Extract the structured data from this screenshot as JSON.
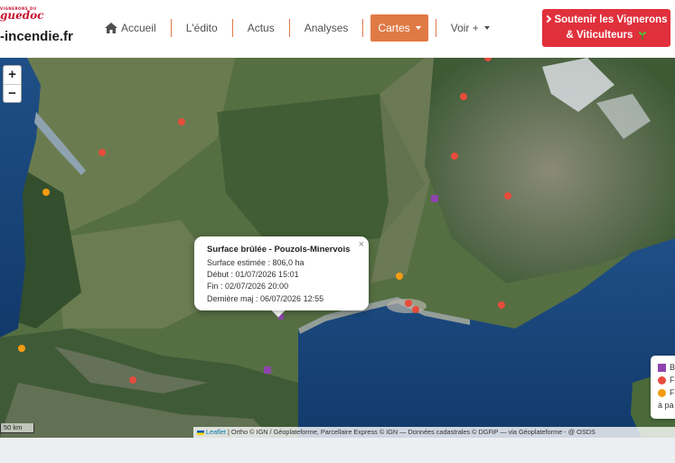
{
  "site": {
    "logo_kicker": "VIGNERONS DU",
    "logo_script": "guedoc",
    "logo_domain": "-incendie.fr"
  },
  "nav": {
    "items": [
      {
        "label": "Accueil",
        "icon": "home-icon"
      },
      {
        "label": "L'édito"
      },
      {
        "label": "Actus"
      },
      {
        "label": "Analyses"
      },
      {
        "label": "Cartes",
        "active": true,
        "dropdown": true
      },
      {
        "label": "Voir +",
        "dropdown": true
      }
    ],
    "active_color": "#e07a45"
  },
  "support_button": {
    "line1": "Soutenir les Vignerons",
    "line2": "& Viticulteurs",
    "color": "#e0303c"
  },
  "map": {
    "zoom_in": "+",
    "zoom_out": "−",
    "popup": {
      "title": "Surface brûlée - Pouzols-Minervois",
      "close": "×",
      "lines": [
        "Surface estimée : 806,0 ha",
        "Début : 01/07/2026 15:01",
        "Fin : 02/07/2026 20:00",
        "Dernière maj : 06/07/2026 12:55"
      ]
    },
    "legend": {
      "rows": [
        {
          "label": "B",
          "color": "#8e44ad",
          "shape": "square"
        },
        {
          "label": "F",
          "color": "#e74c3c",
          "shape": "circle"
        },
        {
          "label": "F",
          "color": "#f39c12",
          "shape": "circle"
        },
        {
          "label": "à pa",
          "color": "",
          "shape": "none"
        }
      ]
    },
    "scale_label": "50 km",
    "attribution": {
      "leaflet": "Leaflet",
      "text": " | Ortho © IGN / Géoplateforme, Parcellaire Express © IGN — Données cadastrales © DGFiP — via Géoplateforme - @ OSDS"
    },
    "marker_colors": {
      "fire": "#e74c3c",
      "old": "#f39c12",
      "burned": "#8e44ad"
    }
  }
}
